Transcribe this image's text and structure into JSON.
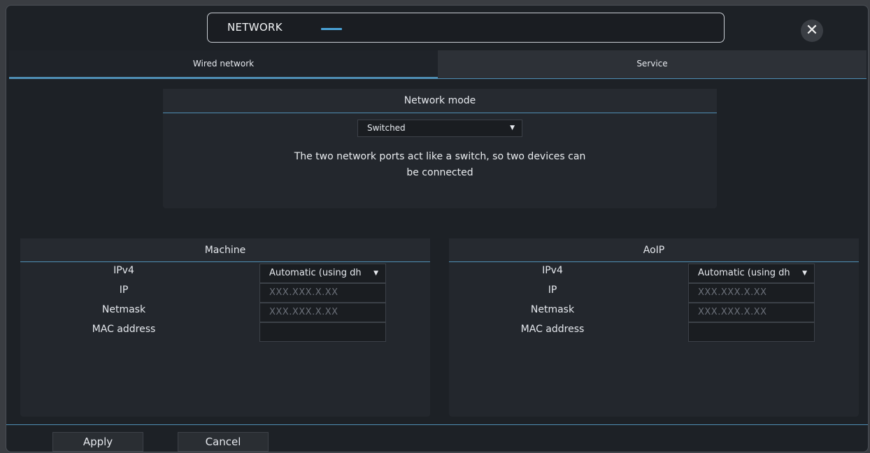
{
  "window": {
    "title": "NETWORK",
    "close_glyph": "✕"
  },
  "tabs": [
    {
      "label": "Wired network",
      "active": true
    },
    {
      "label": "Service",
      "active": false
    }
  ],
  "network_mode": {
    "header": "Network mode",
    "selected": "Switched",
    "arrow": "▼",
    "description_line1": "The two network ports act like a switch, so two devices can",
    "description_line2": "be connected"
  },
  "machine": {
    "title": "Machine",
    "ipv4_label": "IPv4",
    "ipv4_value": "Automatic (using dh",
    "ip_label": "IP",
    "ip_placeholder": "XXX.XXX.X.XX",
    "netmask_label": "Netmask",
    "netmask_placeholder": "XXX.XXX.X.XX",
    "mac_label": "MAC address",
    "mac_value": ""
  },
  "aoip": {
    "title": "AoIP",
    "ipv4_label": "IPv4",
    "ipv4_value": "Automatic (using dh",
    "ip_label": "IP",
    "ip_placeholder": "XXX.XXX.X.XX",
    "netmask_label": "Netmask",
    "netmask_placeholder": "XXX.XXX.X.XX",
    "mac_label": "MAC address",
    "mac_value": ""
  },
  "footer": {
    "apply_label": "Apply",
    "cancel_label": "Cancel"
  },
  "colors": {
    "accent": "#4f8fb5",
    "background": "#1d2126",
    "panel": "#23272d"
  }
}
